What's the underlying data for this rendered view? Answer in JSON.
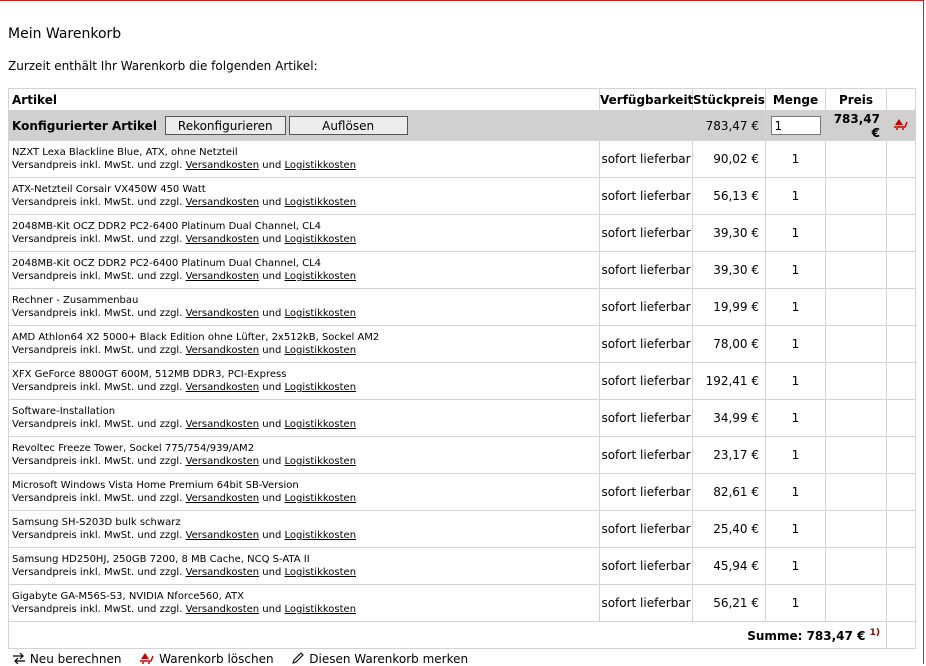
{
  "page": {
    "title": "Mein Warenkorb",
    "intro": "Zurzeit enthält Ihr Warenkorb die folgenden Artikel:"
  },
  "table": {
    "headers": {
      "artikel": "Artikel",
      "verfuegbarkeit": "Verfügbarkeit",
      "stueckpreis": "Stückpreis",
      "menge": "Menge",
      "preis": "Preis"
    },
    "config": {
      "label": "Konfigurierter Artikel",
      "reconfigure_label": "Rekonfigurieren",
      "dissolve_label": "Auflösen",
      "unit_price": "783,47 €",
      "quantity": "1",
      "total": "783,47 €",
      "remove_icon": "cart-remove-icon"
    },
    "shipping_prefix": "Versandpreis inkl. MwSt. und zzgl.",
    "shipping_link": "Versandkosten",
    "shipping_and": "und",
    "logistics_link": "Logistikkosten",
    "items": [
      {
        "name": "NZXT Lexa Blackline Blue, ATX, ohne Netzteil",
        "availability": "sofort lieferbar",
        "price": "90,02 €",
        "qty": "1"
      },
      {
        "name": "ATX-Netzteil Corsair VX450W 450 Watt",
        "availability": "sofort lieferbar",
        "price": "56,13 €",
        "qty": "1"
      },
      {
        "name": "2048MB-Kit OCZ DDR2 PC2-6400 Platinum Dual Channel, CL4",
        "availability": "sofort lieferbar",
        "price": "39,30 €",
        "qty": "1"
      },
      {
        "name": "2048MB-Kit OCZ DDR2 PC2-6400 Platinum Dual Channel, CL4",
        "availability": "sofort lieferbar",
        "price": "39,30 €",
        "qty": "1"
      },
      {
        "name": "Rechner - Zusammenbau",
        "availability": "sofort lieferbar",
        "price": "19,99 €",
        "qty": "1"
      },
      {
        "name": "AMD Athlon64 X2 5000+ Black Edition ohne Lüfter, 2x512kB, Sockel AM2",
        "availability": "sofort lieferbar",
        "price": "78,00 €",
        "qty": "1"
      },
      {
        "name": "XFX GeForce 8800GT 600M, 512MB DDR3, PCI-Express",
        "availability": "sofort lieferbar",
        "price": "192,41 €",
        "qty": "1"
      },
      {
        "name": "Software-Installation",
        "availability": "sofort lieferbar",
        "price": "34,99 €",
        "qty": "1"
      },
      {
        "name": "Revoltec Freeze Tower, Sockel 775/754/939/AM2",
        "availability": "sofort lieferbar",
        "price": "23,17 €",
        "qty": "1"
      },
      {
        "name": "Microsoft Windows Vista Home Premium 64bit SB-Version",
        "availability": "sofort lieferbar",
        "price": "82,61 €",
        "qty": "1"
      },
      {
        "name": "Samsung SH-S203D bulk schwarz",
        "availability": "sofort lieferbar",
        "price": "25,40 €",
        "qty": "1"
      },
      {
        "name": "Samsung HD250HJ, 250GB 7200, 8 MB Cache, NCQ S-ATA II",
        "availability": "sofort lieferbar",
        "price": "45,94 €",
        "qty": "1"
      },
      {
        "name": "Gigabyte GA-M56S-S3, NVIDIA Nforce560, ATX",
        "availability": "sofort lieferbar",
        "price": "56,21 €",
        "qty": "1"
      }
    ],
    "sum": {
      "label": "Summe:",
      "value": "783,47 €",
      "footnote": "1)"
    }
  },
  "footer": {
    "recalc_label": "Neu berechnen",
    "recalc_icon": "recalculate-icon",
    "clear_label": "Warenkorb löschen",
    "clear_icon": "cart-delete-icon",
    "save_label": "Diesen Warenkorb merken",
    "save_icon": "pencil-icon"
  },
  "colors": {
    "config_row_bg": "#d0d0d0",
    "border": "#d3d3d3",
    "accent_red": "#cc0000"
  }
}
